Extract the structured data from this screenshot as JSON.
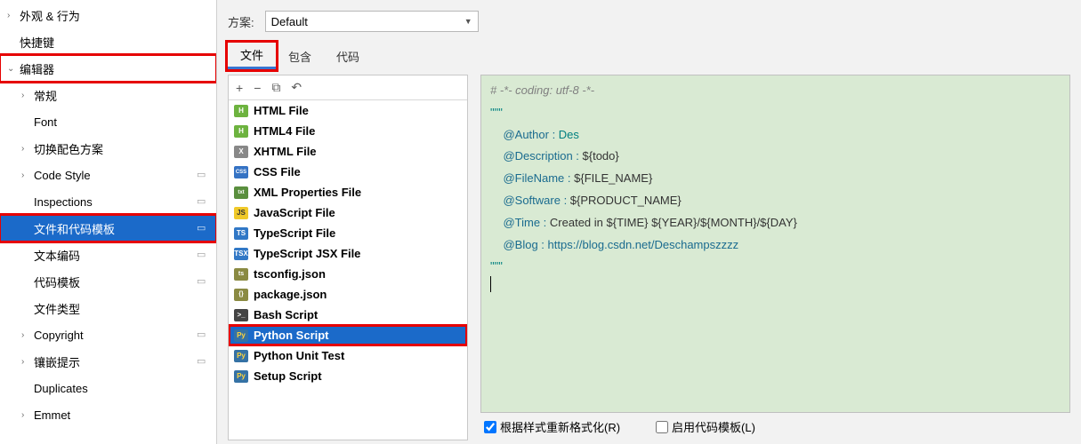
{
  "sidebar": {
    "items": [
      {
        "label": "外观 & 行为",
        "chevron": "›",
        "indent": 0
      },
      {
        "label": "快捷键",
        "chevron": "",
        "indent": 0
      },
      {
        "label": "编辑器",
        "chevron": "⌄",
        "indent": 0,
        "red": true
      },
      {
        "label": "常规",
        "chevron": "›",
        "indent": 1
      },
      {
        "label": "Font",
        "chevron": "",
        "indent": 1
      },
      {
        "label": "切换配色方案",
        "chevron": "›",
        "indent": 1
      },
      {
        "label": "Code Style",
        "chevron": "›",
        "indent": 1,
        "badge": true
      },
      {
        "label": "Inspections",
        "chevron": "",
        "indent": 1,
        "badge": true
      },
      {
        "label": "文件和代码模板",
        "chevron": "",
        "indent": 1,
        "badge": true,
        "selected": true,
        "red": true
      },
      {
        "label": "文本编码",
        "chevron": "",
        "indent": 1,
        "badge": true
      },
      {
        "label": "代码模板",
        "chevron": "",
        "indent": 1,
        "badge": true
      },
      {
        "label": "文件类型",
        "chevron": "",
        "indent": 1
      },
      {
        "label": "Copyright",
        "chevron": "›",
        "indent": 1,
        "badge": true
      },
      {
        "label": "镶嵌提示",
        "chevron": "›",
        "indent": 1,
        "badge": true
      },
      {
        "label": "Duplicates",
        "chevron": "",
        "indent": 1
      },
      {
        "label": "Emmet",
        "chevron": "›",
        "indent": 1
      }
    ]
  },
  "scheme": {
    "label": "方案:",
    "value": "Default"
  },
  "tabs": [
    {
      "label": "文件",
      "active": true,
      "red": true
    },
    {
      "label": "包含",
      "active": false
    },
    {
      "label": "代码",
      "active": false
    }
  ],
  "toolbar": {
    "add": "+",
    "remove": "−",
    "copy": "⧉",
    "undo": "↶"
  },
  "files": [
    {
      "label": "HTML File",
      "icon": "H",
      "cls": "ic-h"
    },
    {
      "label": "HTML4 File",
      "icon": "H",
      "cls": "ic-h"
    },
    {
      "label": "XHTML File",
      "icon": "X",
      "cls": "ic-x"
    },
    {
      "label": "CSS File",
      "icon": "CSS",
      "cls": "ic-css"
    },
    {
      "label": "XML Properties File",
      "icon": "txt",
      "cls": "ic-txt"
    },
    {
      "label": "JavaScript File",
      "icon": "JS",
      "cls": "ic-js"
    },
    {
      "label": "TypeScript File",
      "icon": "TS",
      "cls": "ic-ts"
    },
    {
      "label": "TypeScript JSX File",
      "icon": "TSX",
      "cls": "ic-ts"
    },
    {
      "label": "tsconfig.json",
      "icon": "ts",
      "cls": "ic-json"
    },
    {
      "label": "package.json",
      "icon": "{}",
      "cls": "ic-json"
    },
    {
      "label": "Bash Script",
      "icon": ">_",
      "cls": "ic-sh"
    },
    {
      "label": "Python Script",
      "icon": "Py",
      "cls": "ic-py",
      "selected": true,
      "red": true
    },
    {
      "label": "Python Unit Test",
      "icon": "Py",
      "cls": "ic-py"
    },
    {
      "label": "Setup Script",
      "icon": "Py",
      "cls": "ic-py"
    }
  ],
  "editor": {
    "l1": "# -*- coding: utf-8 -*-",
    "q": "\"\"\"",
    "a1": "@Author : ",
    "a1v": "Des",
    "a2": "@Description : ",
    "a2v": "${todo}",
    "a3": "@FileName : ",
    "a3v": "${FILE_NAME}",
    "a4": "@Software : ",
    "a4v": "${PRODUCT_NAME}",
    "a5": "@Time : ",
    "a5v": "Created in ${TIME} ${YEAR}/${MONTH}/${DAY}",
    "a6": "@Blog : ",
    "a6v": "https://blog.csdn.net/Deschampszzzz",
    "pad": "    "
  },
  "checks": {
    "c1": "根据样式重新格式化(R)",
    "c2": "启用代码模板(L)"
  }
}
